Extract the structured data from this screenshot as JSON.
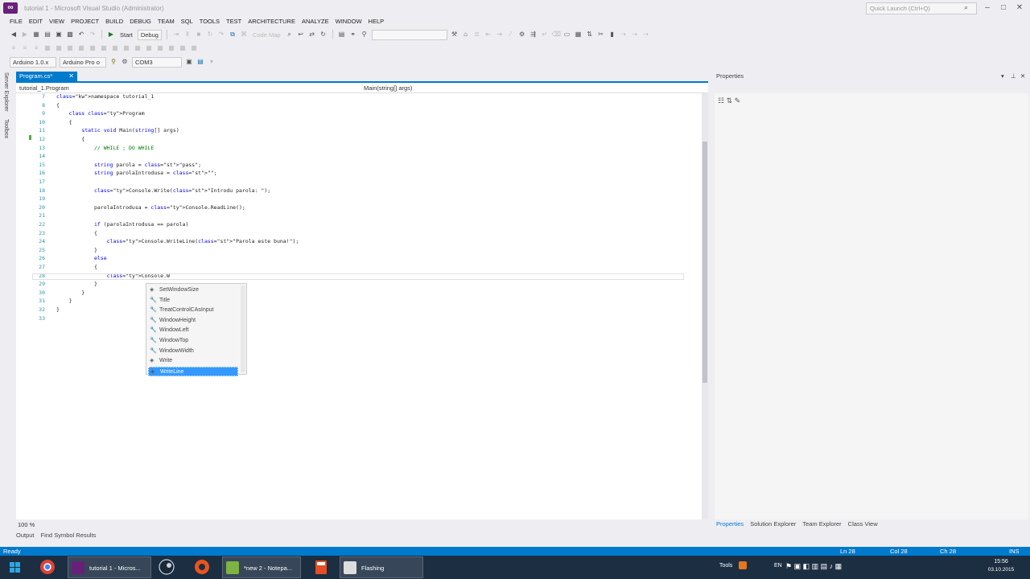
{
  "window": {
    "title": "tutorial 1 - Microsoft Visual Studio (Administrator)",
    "quick_launch_placeholder": "Quick Launch (Ctrl+Q)",
    "buttons": {
      "minimize": "–",
      "maximize": "□",
      "close": "✕"
    }
  },
  "menu": [
    "FILE",
    "EDIT",
    "VIEW",
    "PROJECT",
    "BUILD",
    "DEBUG",
    "TEAM",
    "SQL",
    "TOOLS",
    "TEST",
    "ARCHITECTURE",
    "ANALYZE",
    "WINDOW",
    "HELP"
  ],
  "toolbar1": {
    "start_label": "Start",
    "config": "Debug",
    "code_map": "Code Map"
  },
  "toolbar3": {
    "board": "Arduino 1.0.x",
    "programmer": "Arduino Pro o",
    "port": "COM3"
  },
  "left_rail": [
    "Server Explorer",
    "Toolbox"
  ],
  "document_tab": {
    "label": "Program.cs*",
    "close": "✕"
  },
  "navbar": {
    "left": "tutorial_1.Program",
    "right": "Main(string[] args)"
  },
  "editor": {
    "line_numbers": [
      "7",
      "8",
      "9",
      "10",
      "11",
      "12",
      "13",
      "14",
      "15",
      "16",
      "17",
      "18",
      "19",
      "20",
      "21",
      "22",
      "23",
      "24",
      "25",
      "26",
      "27",
      "28",
      "29",
      "30",
      "31",
      "32",
      "33"
    ],
    "lines": [
      "namespace tutorial_1",
      "{",
      "    class Program",
      "    {",
      "        static void Main(string[] args)",
      "        {",
      "            // WHILE ; DO WHILE",
      "",
      "            string parola = \"pass\";",
      "            string parolaIntrodusa = \"\";",
      "",
      "            Console.Write(\"Introdu parola: \");",
      "",
      "            parolaIntrodusa = Console.ReadLine();",
      "",
      "            if (parolaIntrodusa == parola)",
      "            {",
      "                Console.WriteLine(\"Parola este buna!\");",
      "            }",
      "            else",
      "            {",
      "                Console.W",
      "            }",
      "        }",
      "    }",
      "}",
      ""
    ]
  },
  "completion": {
    "items": [
      {
        "label": "SetWindowSize",
        "icon": "method"
      },
      {
        "label": "Title",
        "icon": "property"
      },
      {
        "label": "TreatControlCAsInput",
        "icon": "property"
      },
      {
        "label": "WindowHeight",
        "icon": "property"
      },
      {
        "label": "WindowLeft",
        "icon": "property"
      },
      {
        "label": "WindowTop",
        "icon": "property"
      },
      {
        "label": "WindowWidth",
        "icon": "property"
      },
      {
        "label": "Write",
        "icon": "method"
      },
      {
        "label": "WriteLine",
        "icon": "method",
        "selected": true
      }
    ]
  },
  "zoom": "100 %",
  "properties": {
    "title": "Properties",
    "tabs": [
      "Properties",
      "Solution Explorer",
      "Team Explorer",
      "Class View"
    ]
  },
  "output_tabs": [
    "Output",
    "Find Symbol Results"
  ],
  "status": {
    "left": "Ready",
    "ln": "Ln 28",
    "col": "Col 28",
    "ch": "Ch 28",
    "mode": "INS"
  },
  "taskbar": {
    "apps": [
      {
        "label": "tutorial 1 - Micros...",
        "color": "#68217a"
      },
      {
        "label": "*new 2 - Notepa...",
        "color": "#7cb342"
      },
      {
        "label": "Flashing",
        "color": "#dddddd"
      }
    ],
    "tray_label": "Tools",
    "lang": "EN",
    "time": "15:56",
    "date": "03.10.2015"
  }
}
